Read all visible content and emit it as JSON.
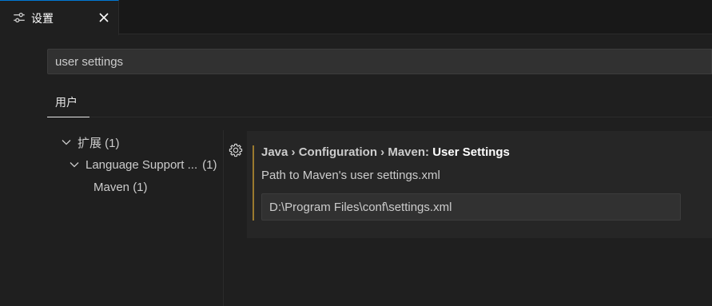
{
  "tab": {
    "title": "设置",
    "icon": "settings-sliders-icon",
    "close_icon": "close-icon"
  },
  "search": {
    "value": "user settings",
    "placeholder": ""
  },
  "scope_tabs": [
    {
      "label": "用户",
      "active": true
    }
  ],
  "toc": {
    "items": [
      {
        "label": "扩展 (1)",
        "expanded": true,
        "level": 0
      },
      {
        "label": "Language Support ...",
        "count": "(1)",
        "expanded": true,
        "level": 1
      },
      {
        "label": "Maven (1)",
        "level": 2
      }
    ]
  },
  "setting": {
    "category": "Java › Configuration › Maven: ",
    "name": "User Settings",
    "description": "Path to Maven's user settings.xml",
    "value": "D:\\Program Files\\conf\\settings.xml",
    "gear_icon": "gear-icon",
    "modified_indicator_color": "#9a7a2e"
  },
  "colors": {
    "background": "#1f1f1f",
    "input_background": "#313131",
    "active_tab_accent": "#0078d4"
  }
}
